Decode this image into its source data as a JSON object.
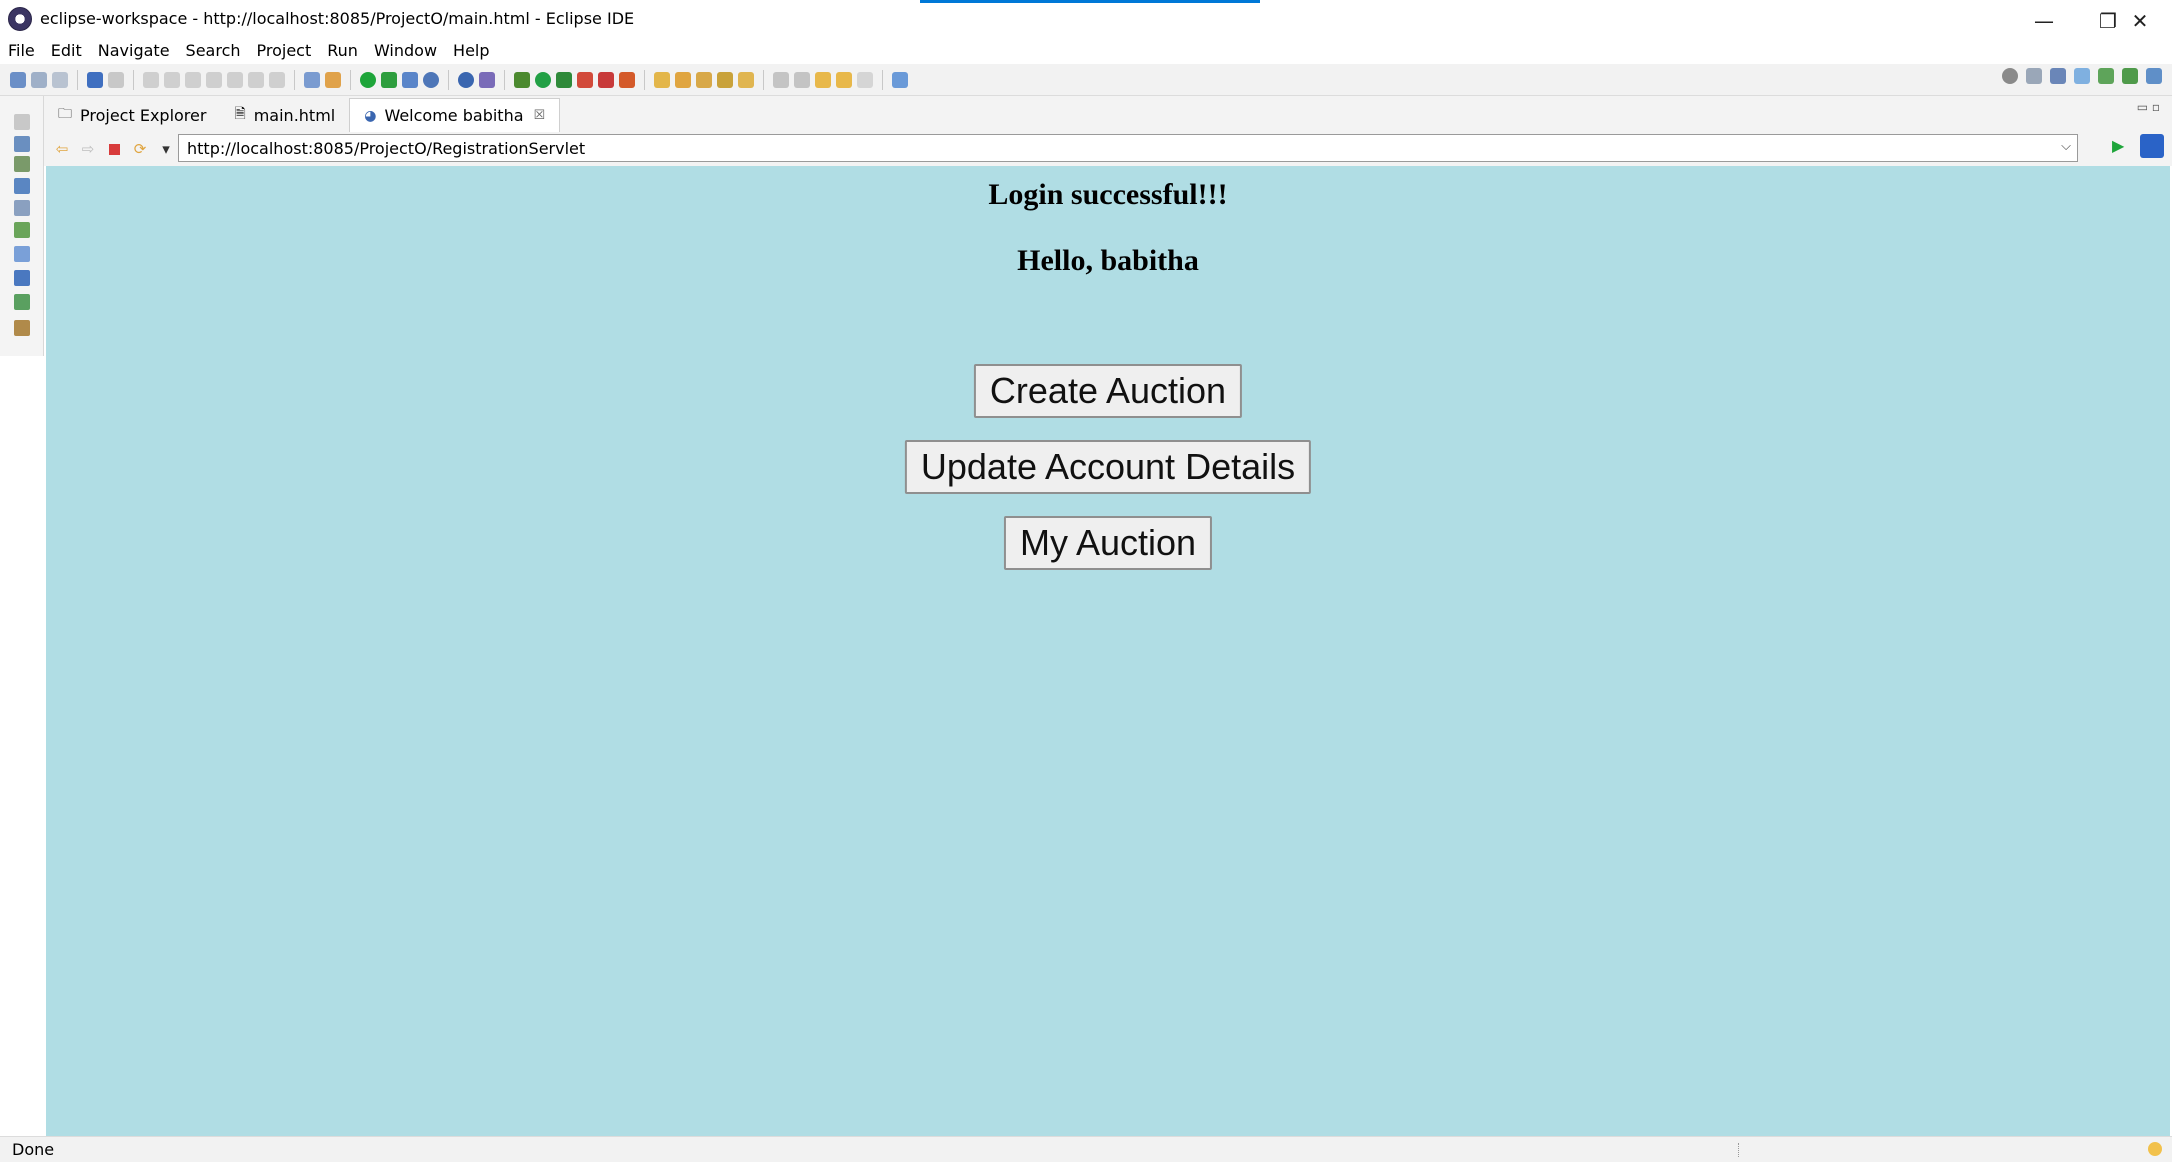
{
  "window": {
    "title": "eclipse-workspace - http://localhost:8085/ProjectO/main.html - Eclipse IDE",
    "controls": {
      "minimize": "—",
      "maximize": "❐",
      "close": "✕"
    }
  },
  "menu": {
    "items": [
      "File",
      "Edit",
      "Navigate",
      "Search",
      "Project",
      "Run",
      "Window",
      "Help"
    ]
  },
  "tabs": [
    {
      "label": "Project Explorer",
      "icon": "project-explorer-icon",
      "glyph": "🗀"
    },
    {
      "label": "main.html",
      "icon": "html-file-icon",
      "glyph": "🗎"
    },
    {
      "label": "Welcome babitha",
      "icon": "globe-icon",
      "glyph": "◕",
      "close": "☒"
    }
  ],
  "browser": {
    "url": "http://localhost:8085/ProjectO/RegistrationServlet",
    "back": "⇦",
    "forward": "⇨",
    "refresh": "⟳",
    "dropdown": "▾",
    "url_dropdown": "⌵",
    "go": "▶"
  },
  "page": {
    "message": "Login successful!!!",
    "greeting": "Hello, babitha",
    "buttons": {
      "create": "Create Auction",
      "update": "Update Account Details",
      "my": "My Auction"
    },
    "background": "#b0dde4"
  },
  "status": {
    "text": "Done"
  },
  "colors": {
    "title_accent": "#0078d7",
    "page_bg": "#b0dde4",
    "stop_red": "#d83b3b",
    "go_green": "#1ea53a"
  }
}
